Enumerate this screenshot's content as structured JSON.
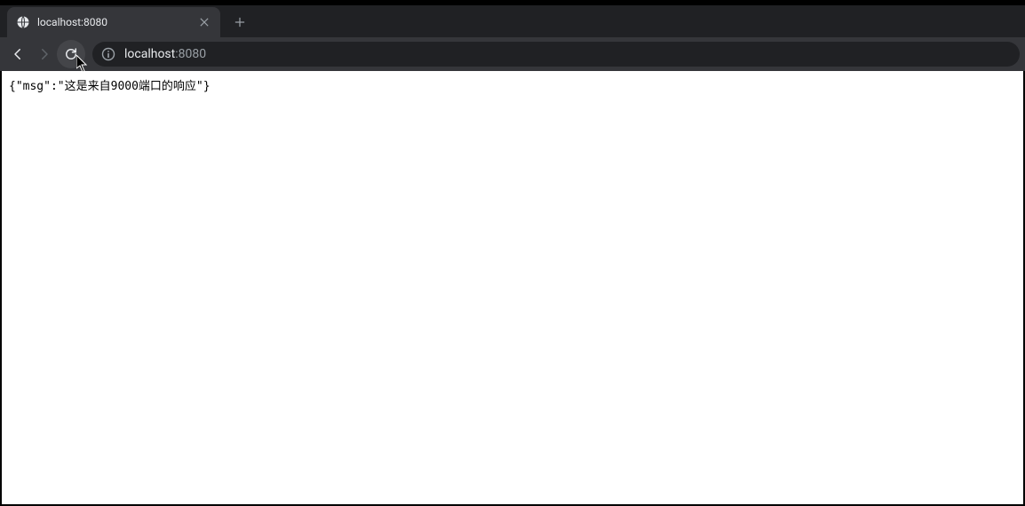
{
  "tab": {
    "title": "localhost:8080"
  },
  "addressBar": {
    "host": "localhost",
    "portSuffix": ":8080"
  },
  "page": {
    "bodyText": "{\"msg\":\"这是来自9000端口的响应\"}"
  }
}
